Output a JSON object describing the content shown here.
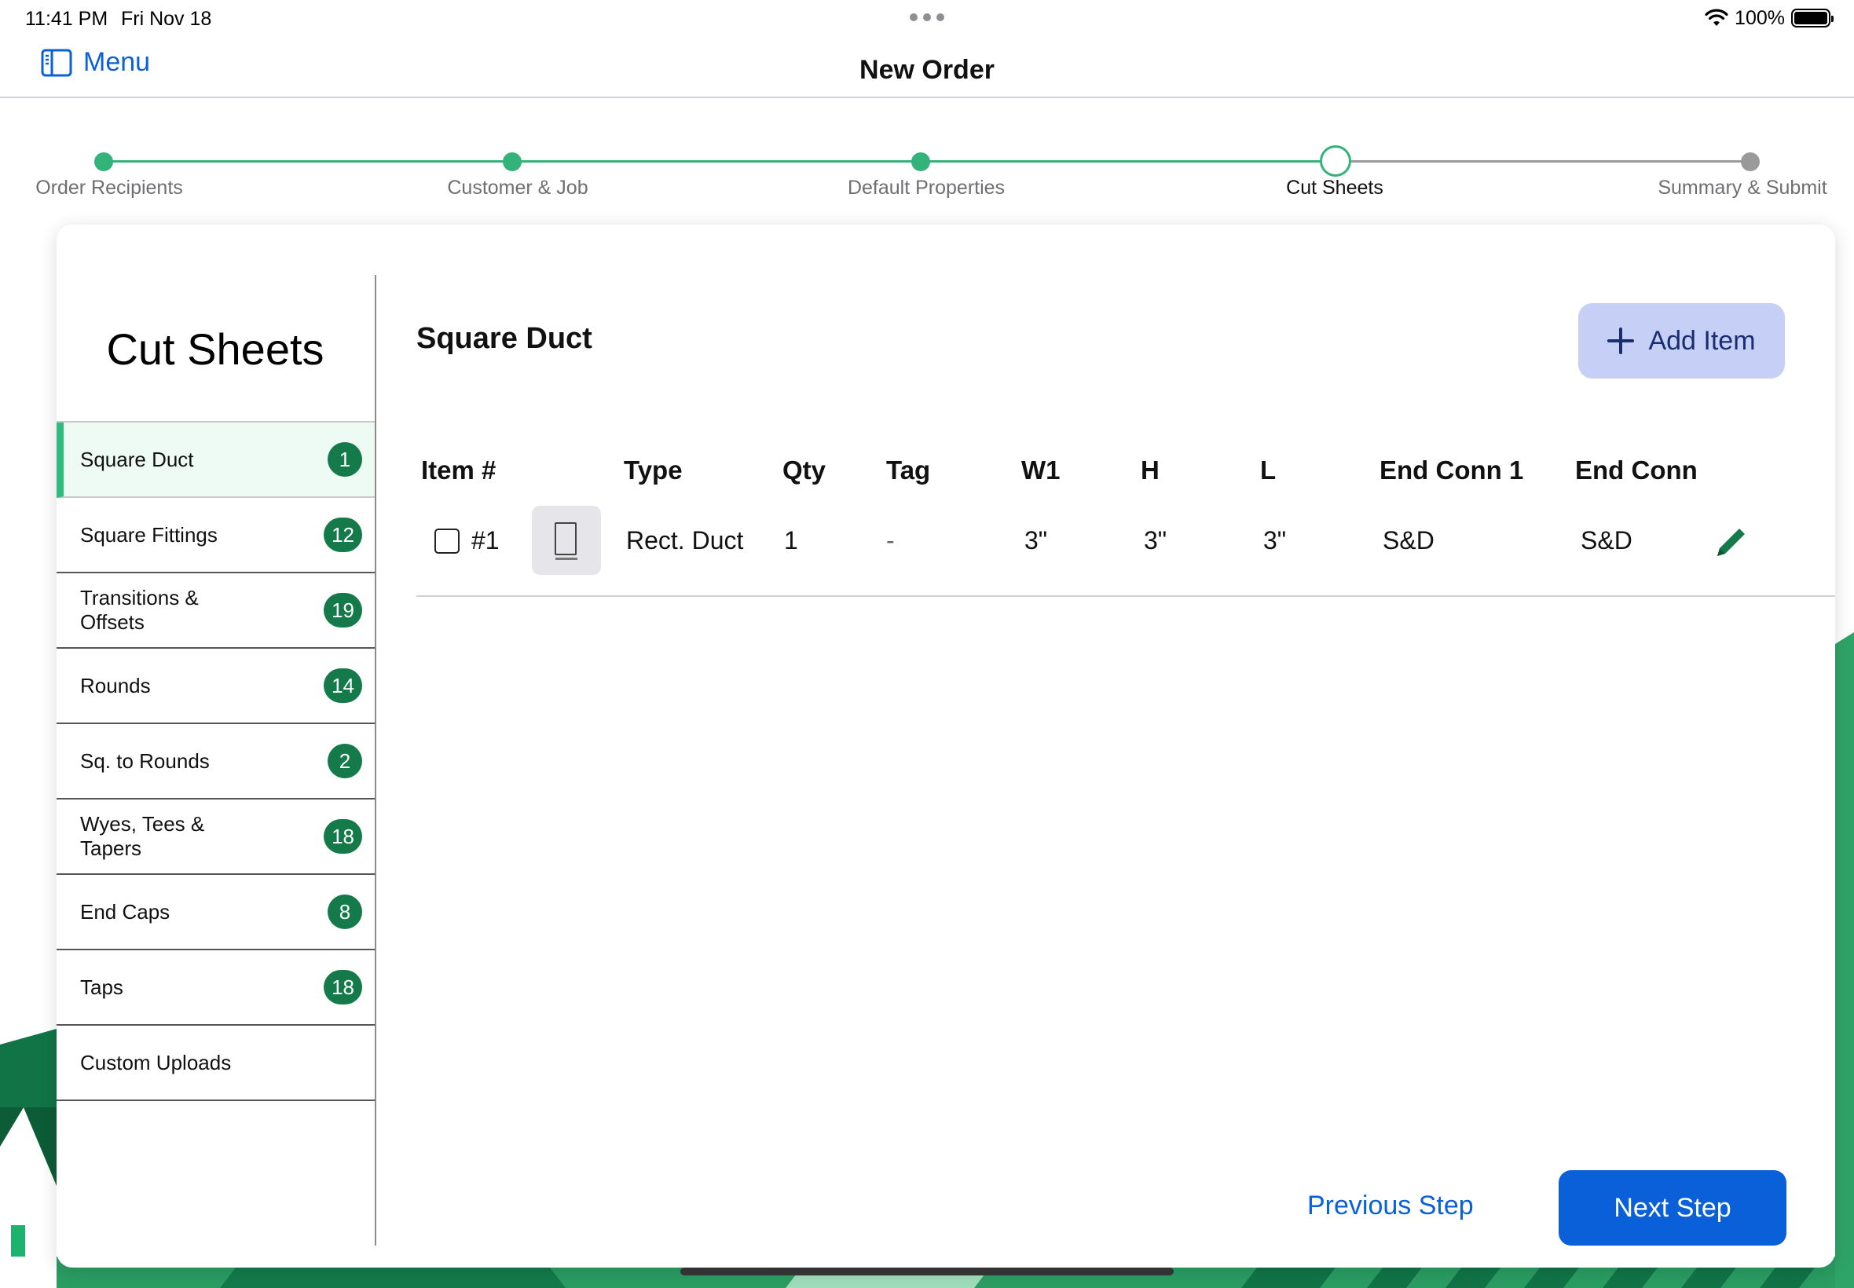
{
  "status_bar": {
    "time": "11:41 PM",
    "date": "Fri Nov 18",
    "battery": "100%"
  },
  "nav": {
    "menu_label": "Menu",
    "title": "New Order"
  },
  "stepper": {
    "steps": [
      {
        "label": "Order Recipients",
        "state": "complete"
      },
      {
        "label": "Customer & Job",
        "state": "complete"
      },
      {
        "label": "Default Properties",
        "state": "complete"
      },
      {
        "label": "Cut Sheets",
        "state": "current"
      },
      {
        "label": "Summary & Submit",
        "state": "upcoming"
      }
    ]
  },
  "sidebar": {
    "title": "Cut Sheets",
    "items": [
      {
        "label": "Square Duct",
        "count": "1",
        "active": true
      },
      {
        "label": "Square Fittings",
        "count": "12"
      },
      {
        "label": "Transitions & Offsets",
        "count": "19"
      },
      {
        "label": "Rounds",
        "count": "14"
      },
      {
        "label": "Sq. to Rounds",
        "count": "2"
      },
      {
        "label": "Wyes, Tees & Tapers",
        "count": "18"
      },
      {
        "label": "End Caps",
        "count": "8"
      },
      {
        "label": "Taps",
        "count": "18"
      },
      {
        "label": "Custom Uploads",
        "count": ""
      }
    ]
  },
  "main": {
    "section_title": "Square Duct",
    "add_item_label": "Add Item",
    "table": {
      "columns": [
        "Item #",
        "Type",
        "Qty",
        "Tag",
        "W1",
        "H",
        "L",
        "End Conn 1",
        "End Conn"
      ],
      "rows": [
        {
          "item": "#1",
          "type": "Rect. Duct",
          "qty": "1",
          "tag": "-",
          "w1": "3\"",
          "h": "3\"",
          "l": "3\"",
          "end_conn_1": "S&D",
          "end_conn_2": "S&D"
        }
      ]
    },
    "previous_label": "Previous Step",
    "next_label": "Next Step"
  },
  "colors": {
    "accent_blue": "#0a60d8",
    "accent_green": "#33b27a",
    "badge_green": "#157a4a",
    "add_button_bg": "#c6d0f7"
  },
  "icons": [
    "sidebar-toggle-icon",
    "wifi-icon",
    "battery-icon",
    "plus-icon",
    "pencil-icon",
    "duct-thumbnail-icon"
  ]
}
